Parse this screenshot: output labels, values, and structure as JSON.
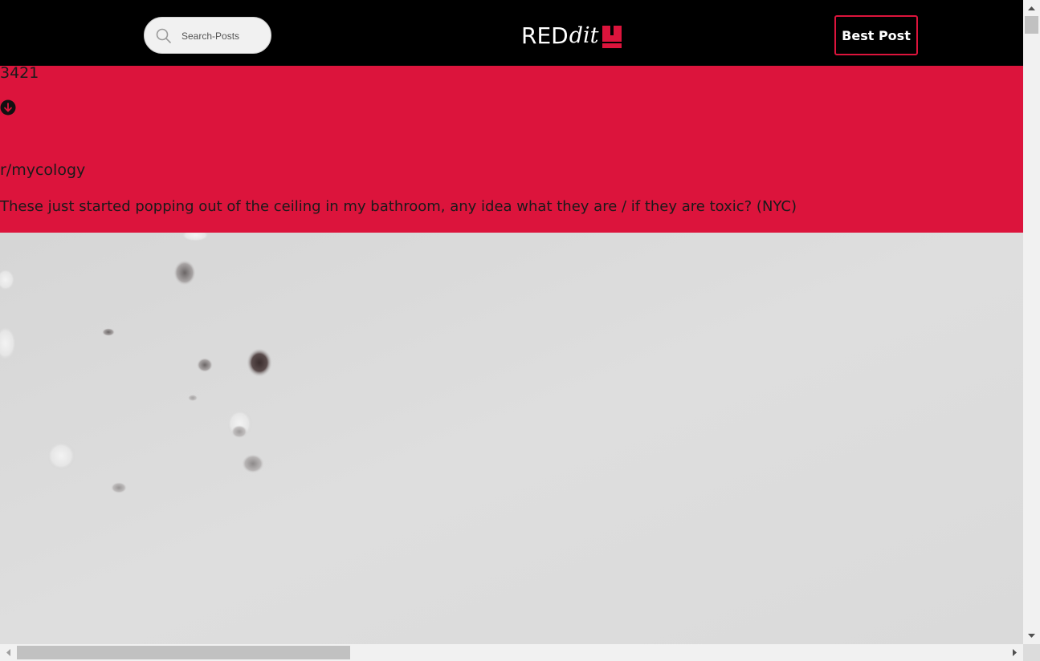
{
  "header": {
    "search": {
      "placeholder": "Search-Posts",
      "icon": "search-icon"
    },
    "logo": {
      "text_main": "RED",
      "text_script": "dit",
      "mark_icon": "reddit-block-mark-icon"
    },
    "best_post_label": "Best Post"
  },
  "post": {
    "score": "3421",
    "downvote_icon": "arrow-down-circle-icon",
    "subreddit": "r/mycology",
    "title": "These just started popping out of the ceiling in my bathroom, any idea what they are / if they are toxic? (NYC)",
    "image_icon": "mushroom-ceiling-photo"
  },
  "colors": {
    "header_bg": "#000000",
    "accent": "#dc143c",
    "text_dark": "#1a1a1a",
    "image_bg": "#dcdcdc"
  }
}
